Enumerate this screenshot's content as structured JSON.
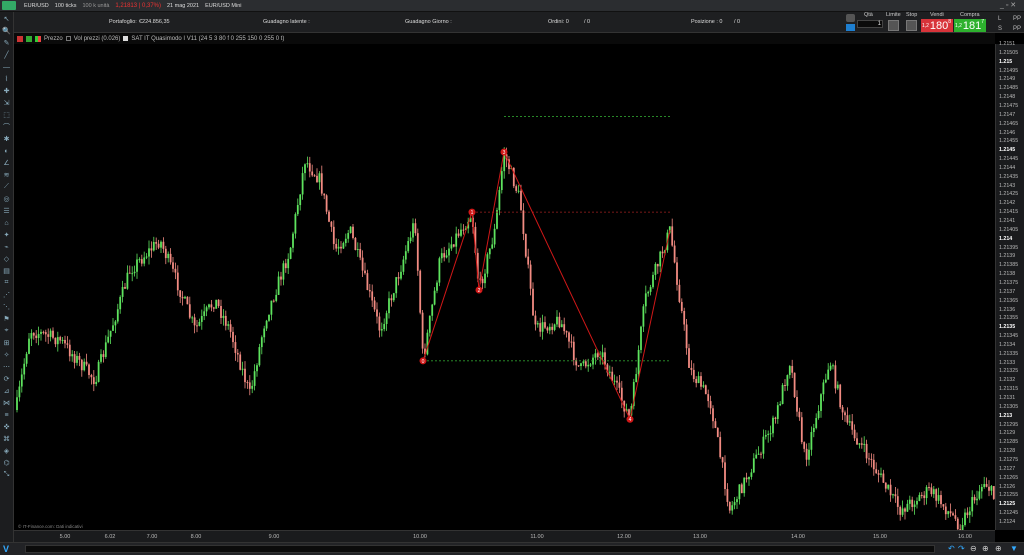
{
  "topbar": {
    "symbol": "EUR/USD",
    "ticks": "100 ticks",
    "units": "100 k unità",
    "quote": "1,21813 | 0,37%)",
    "date": "21 mag 2021",
    "instrument": "EUR/USD Mini"
  },
  "infobar": {
    "portfolio_label": "Portafoglio:",
    "portfolio_value": "€224.856,35",
    "latent_label": "Guadagno latente :",
    "day_label": "Guadagno Giorno :",
    "orders_label": "Ordini: 0",
    "orders_suffix": "/ 0",
    "position_label": "Posizione : 0",
    "position_suffix": "/ 0",
    "qty_label": "Qtà",
    "qty_value": "1",
    "limit_label": "Limite",
    "stop_label": "Stop",
    "sell_label": "Vendi",
    "buy_label": "Compra",
    "sell_prefix": "1,2",
    "sell_price": "180",
    "sell_sup": "8",
    "buy_prefix": "1,2",
    "buy_price": "181",
    "buy_sup": "7",
    "l_label": "L",
    "s_label": "S",
    "pp_label": "PP"
  },
  "legend": {
    "price": "Prezzo",
    "vol": "Vol prezzi (0.026)",
    "indicator": "SAT IT Quasimodo I V11 (24 5 3 80 f 0 255 150 0 255 0 t)"
  },
  "source": "© IT-Finance.com: Dati indicativi",
  "price_labels": [
    "1.2151",
    "1.21505",
    "1.215",
    "1.21495",
    "1.2149",
    "1.21485",
    "1.2148",
    "1.21475",
    "1.2147",
    "1.21465",
    "1.2146",
    "1.21455",
    "1.2145",
    "1.21445",
    "1.2144",
    "1.21435",
    "1.2143",
    "1.21425",
    "1.2142",
    "1.21415",
    "1.2141",
    "1.21405",
    "1.214",
    "1.21395",
    "1.2139",
    "1.21385",
    "1.2138",
    "1.21375",
    "1.2137",
    "1.21365",
    "1.2136",
    "1.21355",
    "1.2135",
    "1.21345",
    "1.2134",
    "1.21335",
    "1.2133",
    "1.21325",
    "1.2132",
    "1.21315",
    "1.2131",
    "1.21305",
    "1.213",
    "1.21295",
    "1.2129",
    "1.21285",
    "1.2128",
    "1.21275",
    "1.2127",
    "1.21265",
    "1.2126",
    "1.21255",
    "1.2125",
    "1.21245",
    "1.2124"
  ],
  "time_labels": [
    "5.00",
    "6.02",
    "7.00",
    "8.00",
    "9.00",
    "10.00",
    "11.00",
    "12.00",
    "13.00",
    "14.00",
    "15.00",
    "16.00"
  ],
  "pattern": {
    "points": [
      {
        "label": "0",
        "price": 1.21331
      },
      {
        "label": "1",
        "price": 1.21415
      },
      {
        "label": "2",
        "price": 1.21371
      },
      {
        "label": "3",
        "price": 1.21449
      },
      {
        "label": "4",
        "price": 1.21298
      },
      {
        "label": "",
        "price": 1.21405
      }
    ],
    "levels": [
      {
        "price": 1.21469,
        "color": "#2e9a2e"
      },
      {
        "price": 1.21415,
        "color": "#a02020"
      },
      {
        "price": 1.21331,
        "color": "#2e9a2e"
      }
    ]
  },
  "colors": {
    "up": "#5ee35e",
    "down": "#f28b82",
    "pattern": "#d01818",
    "sell": "#d8343a",
    "buy": "#2db12e"
  }
}
